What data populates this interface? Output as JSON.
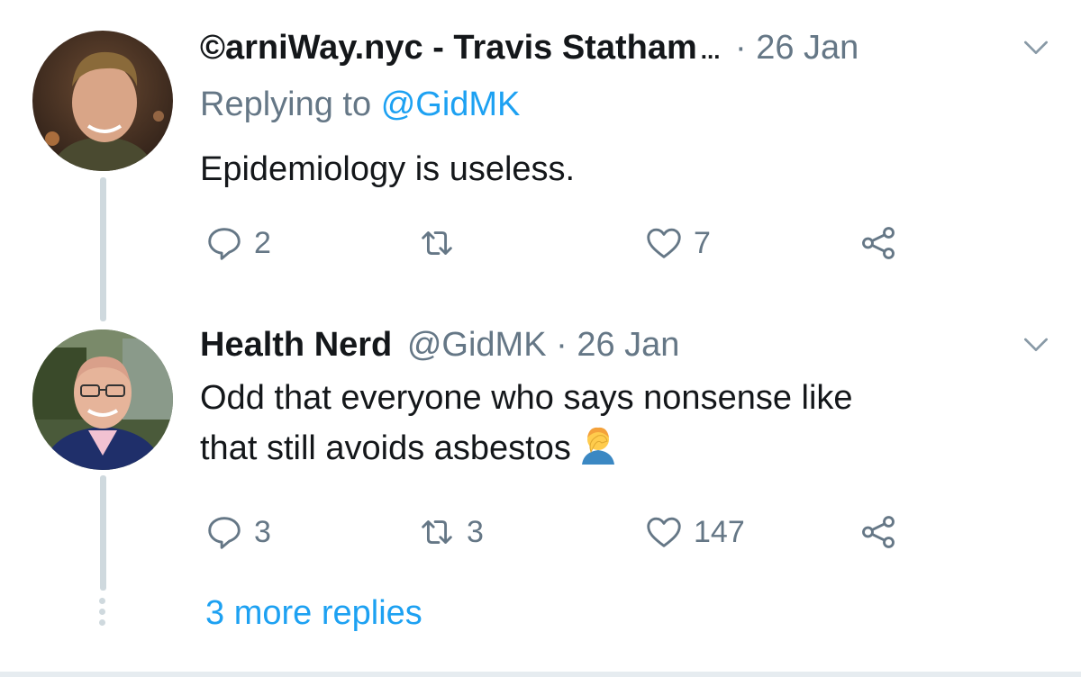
{
  "tweets": [
    {
      "display_name": "©arniWay.nyc - Travis Statham",
      "truncation": "...",
      "date": "· 26 Jan",
      "replying_prefix": "Replying to",
      "replying_to": "@GidMK",
      "text": "Epidemiology is useless.",
      "actions": {
        "replies": "2",
        "retweets": "",
        "likes": "7"
      }
    },
    {
      "display_name": "Health Nerd",
      "handle": "@GidMK",
      "date": "· 26 Jan",
      "text_line1": "Odd that everyone who says nonsense like",
      "text_line2": "that still avoids asbestos",
      "emoji": "facepalm-emoji",
      "actions": {
        "replies": "3",
        "retweets": "3",
        "likes": "147"
      }
    }
  ],
  "more_replies": "3 more replies",
  "colors": {
    "text": "#14171a",
    "secondary": "#657786",
    "accent": "#1da1f2",
    "thread_line": "#cfd9de"
  }
}
